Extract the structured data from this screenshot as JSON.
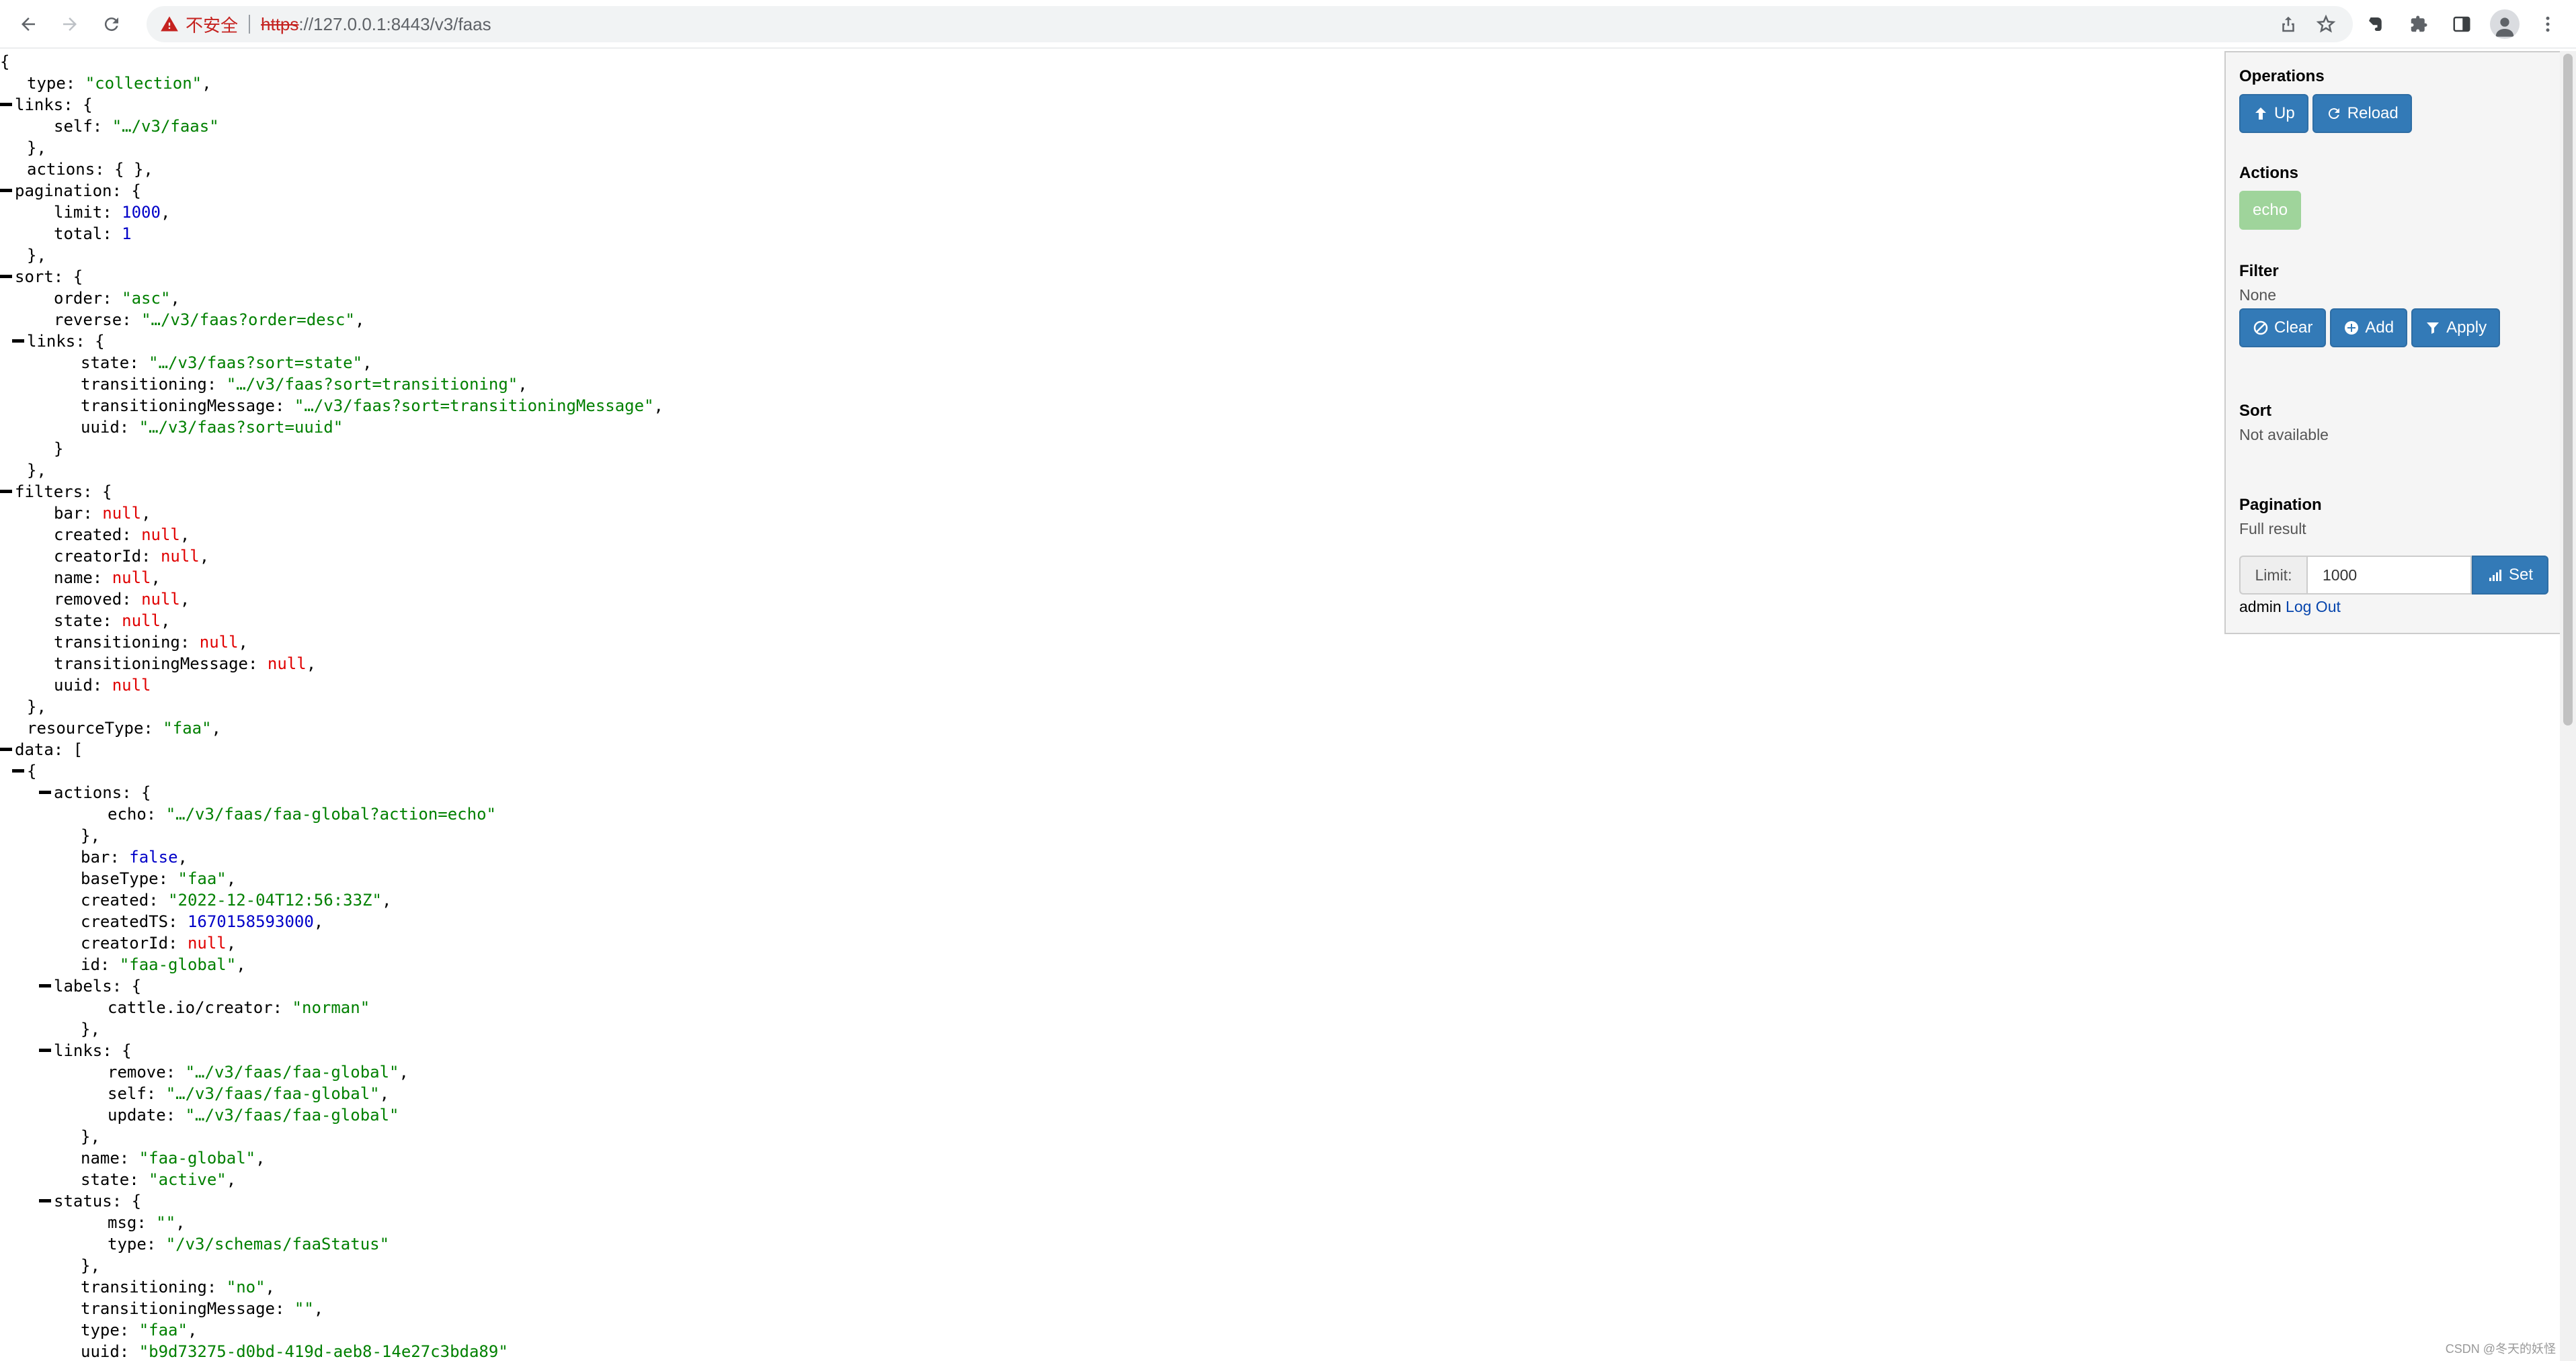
{
  "browser": {
    "insecure_label": "不安全",
    "url_scheme": "https",
    "url_rest": "://127.0.0.1:8443/v3/faas"
  },
  "json_lines": [
    {
      "indent": 0,
      "toggle": false,
      "parts": [
        [
          "p",
          "{"
        ]
      ]
    },
    {
      "indent": 1,
      "toggle": false,
      "parts": [
        [
          "k",
          "type"
        ],
        [
          "p",
          ": "
        ],
        [
          "s",
          "\"collection\""
        ],
        [
          "p",
          ","
        ]
      ]
    },
    {
      "indent": 0,
      "toggle": true,
      "parts": [
        [
          "k",
          "links"
        ],
        [
          "p",
          ": {"
        ]
      ]
    },
    {
      "indent": 2,
      "toggle": false,
      "parts": [
        [
          "k",
          "self"
        ],
        [
          "p",
          ": "
        ],
        [
          "s",
          "\"…/v3/faas\""
        ]
      ]
    },
    {
      "indent": 1,
      "toggle": false,
      "parts": [
        [
          "p",
          "},"
        ]
      ]
    },
    {
      "indent": 1,
      "toggle": false,
      "parts": [
        [
          "k",
          "actions"
        ],
        [
          "p",
          ": { },"
        ]
      ]
    },
    {
      "indent": 0,
      "toggle": true,
      "parts": [
        [
          "k",
          "pagination"
        ],
        [
          "p",
          ": {"
        ]
      ]
    },
    {
      "indent": 2,
      "toggle": false,
      "parts": [
        [
          "k",
          "limit"
        ],
        [
          "p",
          ": "
        ],
        [
          "n",
          "1000"
        ],
        [
          "p",
          ","
        ]
      ]
    },
    {
      "indent": 2,
      "toggle": false,
      "parts": [
        [
          "k",
          "total"
        ],
        [
          "p",
          ": "
        ],
        [
          "n",
          "1"
        ]
      ]
    },
    {
      "indent": 1,
      "toggle": false,
      "parts": [
        [
          "p",
          "},"
        ]
      ]
    },
    {
      "indent": 0,
      "toggle": true,
      "parts": [
        [
          "k",
          "sort"
        ],
        [
          "p",
          ": {"
        ]
      ]
    },
    {
      "indent": 2,
      "toggle": false,
      "parts": [
        [
          "k",
          "order"
        ],
        [
          "p",
          ": "
        ],
        [
          "s",
          "\"asc\""
        ],
        [
          "p",
          ","
        ]
      ]
    },
    {
      "indent": 2,
      "toggle": false,
      "parts": [
        [
          "k",
          "reverse"
        ],
        [
          "p",
          ": "
        ],
        [
          "s",
          "\"…/v3/faas?order=desc\""
        ],
        [
          "p",
          ","
        ]
      ]
    },
    {
      "indent": 1,
      "toggle": true,
      "parts": [
        [
          "k",
          "links"
        ],
        [
          "p",
          ": {"
        ]
      ]
    },
    {
      "indent": 3,
      "toggle": false,
      "parts": [
        [
          "k",
          "state"
        ],
        [
          "p",
          ": "
        ],
        [
          "s",
          "\"…/v3/faas?sort=state\""
        ],
        [
          "p",
          ","
        ]
      ]
    },
    {
      "indent": 3,
      "toggle": false,
      "parts": [
        [
          "k",
          "transitioning"
        ],
        [
          "p",
          ": "
        ],
        [
          "s",
          "\"…/v3/faas?sort=transitioning\""
        ],
        [
          "p",
          ","
        ]
      ]
    },
    {
      "indent": 3,
      "toggle": false,
      "parts": [
        [
          "k",
          "transitioningMessage"
        ],
        [
          "p",
          ": "
        ],
        [
          "s",
          "\"…/v3/faas?sort=transitioningMessage\""
        ],
        [
          "p",
          ","
        ]
      ]
    },
    {
      "indent": 3,
      "toggle": false,
      "parts": [
        [
          "k",
          "uuid"
        ],
        [
          "p",
          ": "
        ],
        [
          "s",
          "\"…/v3/faas?sort=uuid\""
        ]
      ]
    },
    {
      "indent": 2,
      "toggle": false,
      "parts": [
        [
          "p",
          "}"
        ]
      ]
    },
    {
      "indent": 1,
      "toggle": false,
      "parts": [
        [
          "p",
          "},"
        ]
      ]
    },
    {
      "indent": 0,
      "toggle": true,
      "parts": [
        [
          "k",
          "filters"
        ],
        [
          "p",
          ": {"
        ]
      ]
    },
    {
      "indent": 2,
      "toggle": false,
      "parts": [
        [
          "k",
          "bar"
        ],
        [
          "p",
          ": "
        ],
        [
          "nul",
          "null"
        ],
        [
          "p",
          ","
        ]
      ]
    },
    {
      "indent": 2,
      "toggle": false,
      "parts": [
        [
          "k",
          "created"
        ],
        [
          "p",
          ": "
        ],
        [
          "nul",
          "null"
        ],
        [
          "p",
          ","
        ]
      ]
    },
    {
      "indent": 2,
      "toggle": false,
      "parts": [
        [
          "k",
          "creatorId"
        ],
        [
          "p",
          ": "
        ],
        [
          "nul",
          "null"
        ],
        [
          "p",
          ","
        ]
      ]
    },
    {
      "indent": 2,
      "toggle": false,
      "parts": [
        [
          "k",
          "name"
        ],
        [
          "p",
          ": "
        ],
        [
          "nul",
          "null"
        ],
        [
          "p",
          ","
        ]
      ]
    },
    {
      "indent": 2,
      "toggle": false,
      "parts": [
        [
          "k",
          "removed"
        ],
        [
          "p",
          ": "
        ],
        [
          "nul",
          "null"
        ],
        [
          "p",
          ","
        ]
      ]
    },
    {
      "indent": 2,
      "toggle": false,
      "parts": [
        [
          "k",
          "state"
        ],
        [
          "p",
          ": "
        ],
        [
          "nul",
          "null"
        ],
        [
          "p",
          ","
        ]
      ]
    },
    {
      "indent": 2,
      "toggle": false,
      "parts": [
        [
          "k",
          "transitioning"
        ],
        [
          "p",
          ": "
        ],
        [
          "nul",
          "null"
        ],
        [
          "p",
          ","
        ]
      ]
    },
    {
      "indent": 2,
      "toggle": false,
      "parts": [
        [
          "k",
          "transitioningMessage"
        ],
        [
          "p",
          ": "
        ],
        [
          "nul",
          "null"
        ],
        [
          "p",
          ","
        ]
      ]
    },
    {
      "indent": 2,
      "toggle": false,
      "parts": [
        [
          "k",
          "uuid"
        ],
        [
          "p",
          ": "
        ],
        [
          "nul",
          "null"
        ]
      ]
    },
    {
      "indent": 1,
      "toggle": false,
      "parts": [
        [
          "p",
          "},"
        ]
      ]
    },
    {
      "indent": 1,
      "toggle": false,
      "parts": [
        [
          "k",
          "resourceType"
        ],
        [
          "p",
          ": "
        ],
        [
          "s",
          "\"faa\""
        ],
        [
          "p",
          ","
        ]
      ]
    },
    {
      "indent": 0,
      "toggle": true,
      "parts": [
        [
          "k",
          "data"
        ],
        [
          "p",
          ": ["
        ]
      ]
    },
    {
      "indent": 1,
      "toggle": true,
      "parts": [
        [
          "p",
          "{"
        ]
      ]
    },
    {
      "indent": 2,
      "toggle": true,
      "parts": [
        [
          "k",
          "actions"
        ],
        [
          "p",
          ": {"
        ]
      ]
    },
    {
      "indent": 4,
      "toggle": false,
      "parts": [
        [
          "k",
          "echo"
        ],
        [
          "p",
          ": "
        ],
        [
          "s",
          "\"…/v3/faas/faa-global?action=echo\""
        ]
      ]
    },
    {
      "indent": 3,
      "toggle": false,
      "parts": [
        [
          "p",
          "},"
        ]
      ]
    },
    {
      "indent": 3,
      "toggle": false,
      "parts": [
        [
          "k",
          "bar"
        ],
        [
          "p",
          ": "
        ],
        [
          "b",
          "false"
        ],
        [
          "p",
          ","
        ]
      ]
    },
    {
      "indent": 3,
      "toggle": false,
      "parts": [
        [
          "k",
          "baseType"
        ],
        [
          "p",
          ": "
        ],
        [
          "s",
          "\"faa\""
        ],
        [
          "p",
          ","
        ]
      ]
    },
    {
      "indent": 3,
      "toggle": false,
      "parts": [
        [
          "k",
          "created"
        ],
        [
          "p",
          ": "
        ],
        [
          "s",
          "\"2022-12-04T12:56:33Z\""
        ],
        [
          "p",
          ","
        ]
      ]
    },
    {
      "indent": 3,
      "toggle": false,
      "parts": [
        [
          "k",
          "createdTS"
        ],
        [
          "p",
          ": "
        ],
        [
          "n",
          "1670158593000"
        ],
        [
          "p",
          ","
        ]
      ]
    },
    {
      "indent": 3,
      "toggle": false,
      "parts": [
        [
          "k",
          "creatorId"
        ],
        [
          "p",
          ": "
        ],
        [
          "nul",
          "null"
        ],
        [
          "p",
          ","
        ]
      ]
    },
    {
      "indent": 3,
      "toggle": false,
      "parts": [
        [
          "k",
          "id"
        ],
        [
          "p",
          ": "
        ],
        [
          "s",
          "\"faa-global\""
        ],
        [
          "p",
          ","
        ]
      ]
    },
    {
      "indent": 2,
      "toggle": true,
      "parts": [
        [
          "k",
          "labels"
        ],
        [
          "p",
          ": {"
        ]
      ]
    },
    {
      "indent": 4,
      "toggle": false,
      "parts": [
        [
          "k",
          "cattle.io/creator"
        ],
        [
          "p",
          ": "
        ],
        [
          "s",
          "\"norman\""
        ]
      ]
    },
    {
      "indent": 3,
      "toggle": false,
      "parts": [
        [
          "p",
          "},"
        ]
      ]
    },
    {
      "indent": 2,
      "toggle": true,
      "parts": [
        [
          "k",
          "links"
        ],
        [
          "p",
          ": {"
        ]
      ]
    },
    {
      "indent": 4,
      "toggle": false,
      "parts": [
        [
          "k",
          "remove"
        ],
        [
          "p",
          ": "
        ],
        [
          "s",
          "\"…/v3/faas/faa-global\""
        ],
        [
          "p",
          ","
        ]
      ]
    },
    {
      "indent": 4,
      "toggle": false,
      "parts": [
        [
          "k",
          "self"
        ],
        [
          "p",
          ": "
        ],
        [
          "s",
          "\"…/v3/faas/faa-global\""
        ],
        [
          "p",
          ","
        ]
      ]
    },
    {
      "indent": 4,
      "toggle": false,
      "parts": [
        [
          "k",
          "update"
        ],
        [
          "p",
          ": "
        ],
        [
          "s",
          "\"…/v3/faas/faa-global\""
        ]
      ]
    },
    {
      "indent": 3,
      "toggle": false,
      "parts": [
        [
          "p",
          "},"
        ]
      ]
    },
    {
      "indent": 3,
      "toggle": false,
      "parts": [
        [
          "k",
          "name"
        ],
        [
          "p",
          ": "
        ],
        [
          "s",
          "\"faa-global\""
        ],
        [
          "p",
          ","
        ]
      ]
    },
    {
      "indent": 3,
      "toggle": false,
      "parts": [
        [
          "k",
          "state"
        ],
        [
          "p",
          ": "
        ],
        [
          "s",
          "\"active\""
        ],
        [
          "p",
          ","
        ]
      ]
    },
    {
      "indent": 2,
      "toggle": true,
      "parts": [
        [
          "k",
          "status"
        ],
        [
          "p",
          ": {"
        ]
      ]
    },
    {
      "indent": 4,
      "toggle": false,
      "parts": [
        [
          "k",
          "msg"
        ],
        [
          "p",
          ": "
        ],
        [
          "s",
          "\"\""
        ],
        [
          "p",
          ","
        ]
      ]
    },
    {
      "indent": 4,
      "toggle": false,
      "parts": [
        [
          "k",
          "type"
        ],
        [
          "p",
          ": "
        ],
        [
          "s",
          "\"/v3/schemas/faaStatus\""
        ]
      ]
    },
    {
      "indent": 3,
      "toggle": false,
      "parts": [
        [
          "p",
          "},"
        ]
      ]
    },
    {
      "indent": 3,
      "toggle": false,
      "parts": [
        [
          "k",
          "transitioning"
        ],
        [
          "p",
          ": "
        ],
        [
          "s",
          "\"no\""
        ],
        [
          "p",
          ","
        ]
      ]
    },
    {
      "indent": 3,
      "toggle": false,
      "parts": [
        [
          "k",
          "transitioningMessage"
        ],
        [
          "p",
          ": "
        ],
        [
          "s",
          "\"\""
        ],
        [
          "p",
          ","
        ]
      ]
    },
    {
      "indent": 3,
      "toggle": false,
      "parts": [
        [
          "k",
          "type"
        ],
        [
          "p",
          ": "
        ],
        [
          "s",
          "\"faa\""
        ],
        [
          "p",
          ","
        ]
      ]
    },
    {
      "indent": 3,
      "toggle": false,
      "parts": [
        [
          "k",
          "uuid"
        ],
        [
          "p",
          ": "
        ],
        [
          "s",
          "\"b9d73275-d0bd-419d-aeb8-14e27c3bda89\""
        ]
      ]
    }
  ],
  "panel": {
    "operations": {
      "title": "Operations",
      "up_label": "Up",
      "reload_label": "Reload"
    },
    "actions": {
      "title": "Actions",
      "echo_label": "echo"
    },
    "filter": {
      "title": "Filter",
      "value": "None",
      "clear_label": "Clear",
      "add_label": "Add",
      "apply_label": "Apply"
    },
    "sort": {
      "title": "Sort",
      "value": "Not available"
    },
    "pagination": {
      "title": "Pagination",
      "value": "Full result",
      "limit_label": "Limit:",
      "limit_value": "1000",
      "set_label": "Set"
    },
    "user": {
      "username": "admin",
      "logout_label": "Log Out"
    }
  },
  "watermark": "CSDN @冬天的妖怪"
}
